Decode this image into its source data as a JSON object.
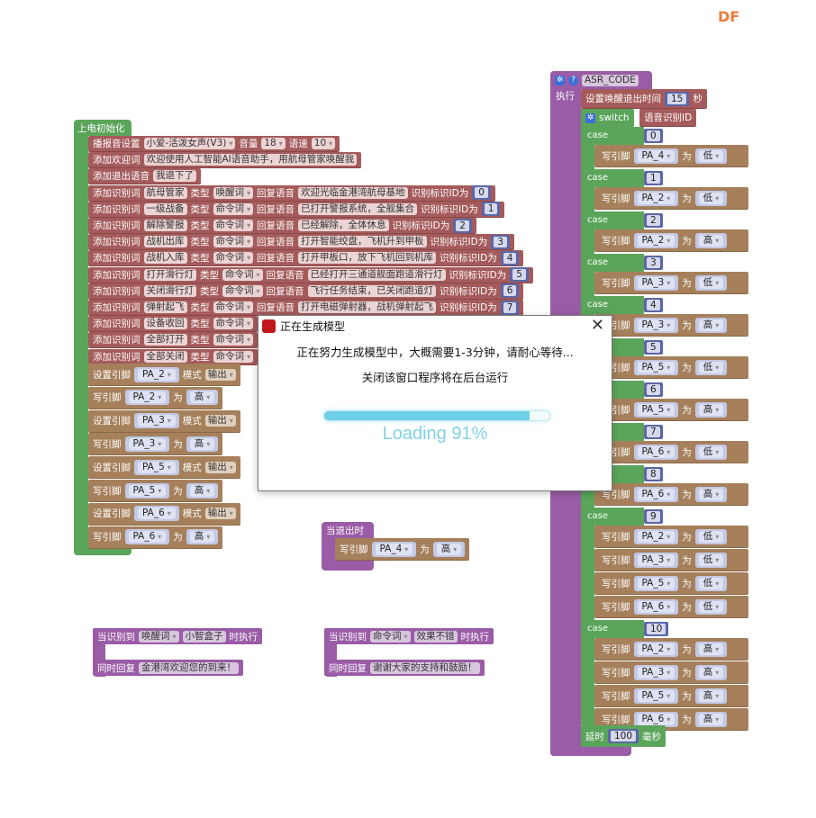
{
  "logo": "DF",
  "colors": {
    "init_block": "#5ba55b",
    "voice_block": "#a55b5b",
    "pin_block": "#a5805b",
    "event_block": "#9a5ca6",
    "number_block": "#5b67a5",
    "progress": "#6dd0e6"
  },
  "labels": {
    "add_word": "添加识别词",
    "type": "类型",
    "reply": "回复语音",
    "id": "识别标识ID为",
    "set_pin": "设置引脚",
    "mode": "模式",
    "write_pin": "写引脚",
    "to": "为",
    "case": "case"
  },
  "init": {
    "hat": "上电初始化",
    "voice": {
      "label": "播报音设置",
      "voice": "小爱-活泼女声(V3)",
      "volume_label": "音量",
      "volume": "18",
      "speed_label": "语速",
      "speed": "10"
    },
    "welcome": {
      "label": "添加欢迎词",
      "text": "欢迎使用人工智能AI语音助手，用航母管家唤醒我"
    },
    "exit": {
      "label": "添加退出语音",
      "text": "我退下了"
    },
    "keywords": [
      {
        "word": "航母管家",
        "type": "唤醒词",
        "reply": "欢迎光临金港湾航母基地",
        "id": "0"
      },
      {
        "word": "一级战备",
        "type": "命令词",
        "reply": "已打开警报系统，全舰集合",
        "id": "1"
      },
      {
        "word": "解除警报",
        "type": "命令词",
        "reply": "已经解除，全体休息",
        "id": "2"
      },
      {
        "word": "战机出库",
        "type": "命令词",
        "reply": "打开智能绞盘，飞机升到甲板",
        "id": "3"
      },
      {
        "word": "战机入库",
        "type": "命令词",
        "reply": "打开甲板口，放下飞机回到机库",
        "id": "4"
      },
      {
        "word": "打开滑行灯",
        "type": "命令词",
        "reply": "已经打开三通道舰面跑道滑行灯",
        "id": "5"
      },
      {
        "word": "关闭滑行灯",
        "type": "命令词",
        "reply": "飞行任务结束，已关闭跑道灯",
        "id": "6"
      },
      {
        "word": "弹射起飞",
        "type": "命令词",
        "reply": "打开电磁弹射器，战机弹射起飞",
        "id": "7"
      },
      {
        "word": "设备收回",
        "type": "命令词"
      },
      {
        "word": "全部打开",
        "type": "命令词"
      },
      {
        "word": "全部关闭",
        "type": "命令词"
      }
    ],
    "pins": [
      {
        "op": "set",
        "pin": "PA_2",
        "value": "输出"
      },
      {
        "op": "write",
        "pin": "PA_2",
        "value": "高"
      },
      {
        "op": "set",
        "pin": "PA_3",
        "value": "输出"
      },
      {
        "op": "write",
        "pin": "PA_3",
        "value": "高"
      },
      {
        "op": "set",
        "pin": "PA_5",
        "value": "输出"
      },
      {
        "op": "write",
        "pin": "PA_5",
        "value": "高"
      },
      {
        "op": "set",
        "pin": "PA_6",
        "value": "输出"
      },
      {
        "op": "write",
        "pin": "PA_6",
        "value": "高"
      }
    ]
  },
  "on_exit": {
    "hat": "当退出时",
    "pin": "PA_4",
    "value": "高"
  },
  "events": [
    {
      "label": "当识别到",
      "type": "唤醒词",
      "word": "小智盒子",
      "suffix": "时执行",
      "reply_label": "同时回复",
      "reply": "金港湾欢迎您的到来！"
    },
    {
      "label": "当识别到",
      "type": "命令词",
      "word": "效果不错",
      "suffix": "时执行",
      "reply_label": "同时回复",
      "reply": "谢谢大家的支持和鼓励！"
    }
  ],
  "asr": {
    "name": "ASR_CODE",
    "exec": "执行",
    "timeout_label": "设置唤醒退出时间",
    "timeout": "15",
    "timeout_unit": "秒",
    "switch": "switch",
    "switch_var": "语音识别ID",
    "cases": [
      {
        "n": "0",
        "writes": [
          {
            "pin": "PA_4",
            "value": "低"
          }
        ]
      },
      {
        "n": "1",
        "writes": [
          {
            "pin": "PA_2",
            "value": "低"
          }
        ]
      },
      {
        "n": "2",
        "writes": [
          {
            "pin": "PA_2",
            "value": "高"
          }
        ]
      },
      {
        "n": "3",
        "writes": [
          {
            "pin": "PA_3",
            "value": "低"
          }
        ]
      },
      {
        "n": "4",
        "writes": [
          {
            "pin": "PA_3",
            "value": "高"
          }
        ]
      },
      {
        "n": "5",
        "writes": [
          {
            "pin": "PA_5",
            "value": "低"
          }
        ]
      },
      {
        "n": "6",
        "writes": [
          {
            "pin": "PA_5",
            "value": "高"
          }
        ]
      },
      {
        "n": "7",
        "writes": [
          {
            "pin": "PA_6",
            "value": "低"
          }
        ]
      },
      {
        "n": "8",
        "writes": [
          {
            "pin": "PA_6",
            "value": "高"
          }
        ]
      },
      {
        "n": "9",
        "writes": [
          {
            "pin": "PA_2",
            "value": "低"
          },
          {
            "pin": "PA_3",
            "value": "低"
          },
          {
            "pin": "PA_5",
            "value": "低"
          },
          {
            "pin": "PA_6",
            "value": "低"
          }
        ]
      },
      {
        "n": "10",
        "writes": [
          {
            "pin": "PA_2",
            "value": "高"
          },
          {
            "pin": "PA_3",
            "value": "高"
          },
          {
            "pin": "PA_5",
            "value": "高"
          },
          {
            "pin": "PA_6",
            "value": "高"
          }
        ]
      }
    ],
    "delay_label": "延时",
    "delay": "100",
    "delay_unit": "毫秒"
  },
  "dialog": {
    "title": "正在生成模型",
    "message": "正在努力生成模型中，大概需要1-3分钟，请耐心等待...",
    "note": "关闭该窗口程序将在后台运行",
    "progress_percent": 91,
    "loading_text": "Loading 91%"
  }
}
